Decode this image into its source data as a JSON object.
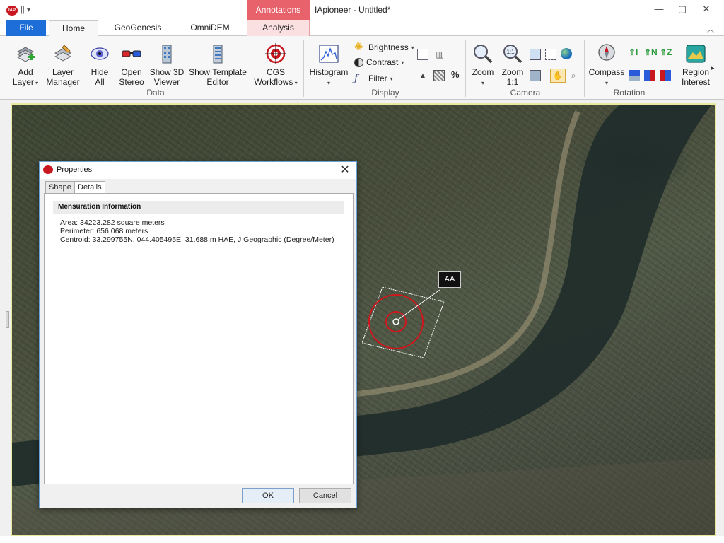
{
  "window": {
    "title": "IApioneer - Untitled*",
    "context_group": "Annotations",
    "minimize": "—",
    "maximize": "▢",
    "close": "✕"
  },
  "tabs": {
    "file": "File",
    "home": "Home",
    "geogenesis": "GeoGenesis",
    "omnidem": "OmniDEM",
    "analysis": "Analysis"
  },
  "ribbon": {
    "data": {
      "label": "Data",
      "add_layer": [
        "Add",
        "Layer"
      ],
      "layer_manager": [
        "Layer",
        "Manager"
      ],
      "hide_all": [
        "Hide",
        "All"
      ],
      "open_stereo": [
        "Open",
        "Stereo"
      ],
      "show_3d_viewer": [
        "Show 3D",
        "Viewer"
      ],
      "show_template_editor": [
        "Show Template",
        "Editor"
      ],
      "cgs_workflows": [
        "CGS",
        "Workflows"
      ]
    },
    "display": {
      "label": "Display",
      "histogram": "Histogram",
      "brightness": "Brightness",
      "contrast": "Contrast",
      "filter": "Filter",
      "percent": "%"
    },
    "camera": {
      "label": "Camera",
      "zoom": "Zoom",
      "zoom_1_1": [
        "Zoom",
        "1:1"
      ],
      "zoom_1_1_icon": "1:1"
    },
    "rotation": {
      "label": "Rotation",
      "compass": "Compass"
    },
    "region": {
      "label": [
        "Region",
        "Interest"
      ]
    }
  },
  "map": {
    "annotation_label": "AA"
  },
  "dialog": {
    "title": "Properties",
    "tabs": [
      "Shape",
      "Details"
    ],
    "section": "Mensuration Information",
    "area": "Area: 34223.282 square meters",
    "perimeter": "Perimeter: 656.068 meters",
    "centroid": "Centroid: 33.299755N, 044.405495E, 31.688 m HAE, J Geographic (Degree/Meter)",
    "ok": "OK",
    "cancel": "Cancel"
  },
  "colors": {
    "file_tab": "#1e6ed9",
    "annotations_tab": "#e8626b",
    "annotation_circle": "#d0161c",
    "map_border": "#e8e8a0"
  }
}
